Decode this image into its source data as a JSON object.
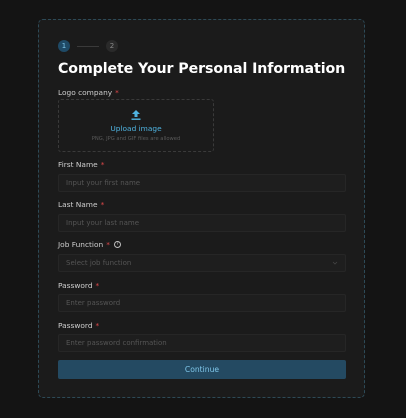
{
  "stepper": {
    "steps": [
      {
        "number": "1",
        "state": "active"
      },
      {
        "number": "2",
        "state": "inactive"
      }
    ]
  },
  "form": {
    "title": "Complete Your Personal Information",
    "required_marker": "*",
    "logo": {
      "label": "Logo company",
      "upload_label": "Upload image",
      "hint": "PNG, JPG and GIF files are allowed",
      "icon": "upload-arrow-icon"
    },
    "first_name": {
      "label": "First Name",
      "placeholder": "Input your first name"
    },
    "last_name": {
      "label": "Last Name",
      "placeholder": "Input your last name"
    },
    "job_function": {
      "label": "Job Function",
      "placeholder": "Select job function",
      "help_icon": "help-circle-icon",
      "help_glyph": "?"
    },
    "password": {
      "label": "Password",
      "placeholder": "Enter password"
    },
    "password_confirm": {
      "label": "Password",
      "placeholder": "Enter password confirmation"
    },
    "submit_label": "Continue"
  },
  "colors": {
    "background": "#141414",
    "card": "#1b1b1b",
    "accent": "#4fb3e0",
    "button": "#244a62",
    "required": "#e0484a"
  }
}
